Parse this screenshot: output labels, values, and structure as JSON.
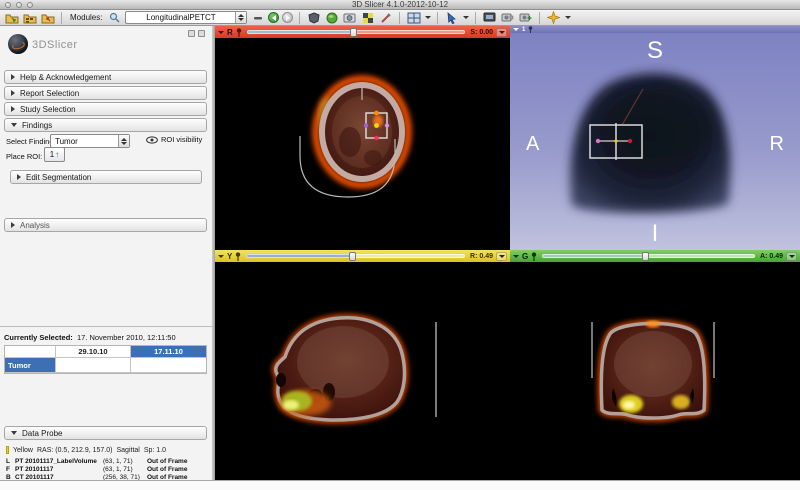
{
  "window": {
    "title": "3D Slicer 4.1.0-2012-10-12"
  },
  "toolbar": {
    "modules_label": "Modules:",
    "module_select_value": "LongitudinalPETCT",
    "icons": [
      "load-scene-icon",
      "load-dicom-icon",
      "save-scene-icon",
      "module-search-icon",
      "module-history-icon",
      "previous-module-button",
      "next-module-button",
      "shield-module-icon",
      "globe-module-icon",
      "camera-module-icon",
      "checkerboard-module-icon",
      "pen-module-icon",
      "layout-grid-icon",
      "mouse-interaction-icon",
      "screen-capture-icon",
      "scene-view-icon",
      "scene-view-add-icon",
      "crosshair-star-icon"
    ]
  },
  "panel": {
    "logo_text": "3DSlicer",
    "sections": {
      "help": "Help & Acknowledgement",
      "report": "Report Selection",
      "study": "Study Selection",
      "findings": "Findings",
      "edit_segmentation": "Edit Segmentation",
      "analysis": "Analysis",
      "data_probe": "Data Probe"
    },
    "findings": {
      "select_finding_label": "Select Finding:",
      "finding_value": "Tumor",
      "roi_visibility_label": "ROI visibility",
      "place_roi_label": "Place ROI:",
      "place_roi_button_label": "1",
      "place_roi_button_arrow": "↑"
    },
    "currently_selected": {
      "label": "Currently Selected:",
      "value": "17. November 2010, 12:11:50"
    },
    "study_table": {
      "col1": "29.10.10",
      "col2": "17.11.10",
      "row1": "Tumor"
    },
    "data_probe": {
      "view_color": "Yellow",
      "ras": "RAS: (0.5, 212.9, 157.0)",
      "orientation": "Sagittal",
      "spacing": "Sp: 1.0",
      "layers": [
        {
          "code": "L",
          "name": "PT 20101117_LabelVolume",
          "ijk": "(63, 1, 71)",
          "value": "Out of Frame"
        },
        {
          "code": "F",
          "name": "PT 20101117",
          "ijk": "(63, 1, 71)",
          "value": "Out of Frame"
        },
        {
          "code": "B",
          "name": "CT 20101117",
          "ijk": "(256, 38, 71)",
          "value": "Out of Frame"
        }
      ]
    }
  },
  "views": {
    "red": {
      "label": "R",
      "offset": "S: 0.00",
      "color": "#e5412e"
    },
    "yellow": {
      "label": "Y",
      "offset": "R: 0.49",
      "color": "#edd93c"
    },
    "green": {
      "label": "G",
      "offset": "A: 0.49",
      "color": "#6dc054"
    },
    "threed": {
      "label": "1",
      "color": "#7b80c4",
      "top": "S",
      "left": "A",
      "right": "R",
      "bottom": "I"
    }
  }
}
